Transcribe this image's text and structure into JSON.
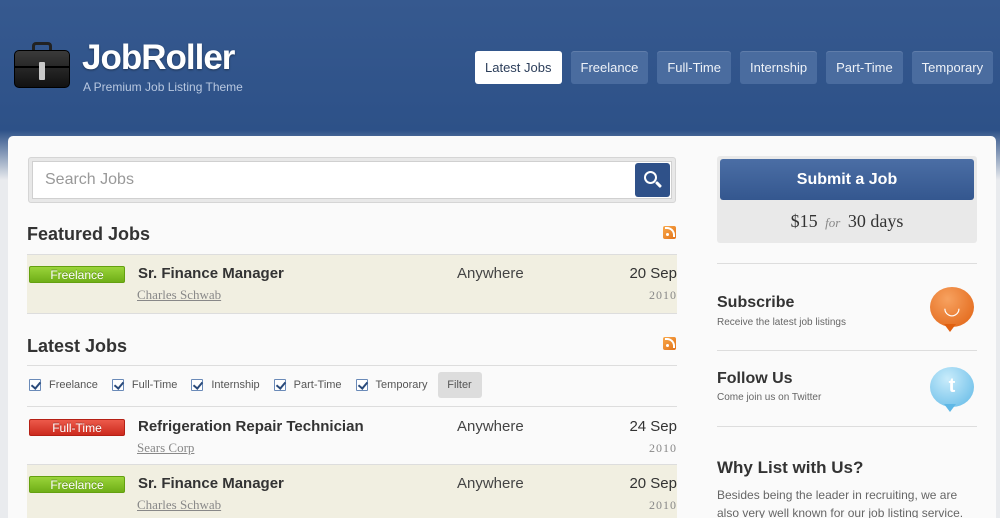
{
  "brand": {
    "title": "JobRoller",
    "tagline": "A Premium Job Listing Theme"
  },
  "nav": [
    {
      "label": "Latest Jobs",
      "active": true
    },
    {
      "label": "Freelance",
      "active": false
    },
    {
      "label": "Full-Time",
      "active": false
    },
    {
      "label": "Internship",
      "active": false
    },
    {
      "label": "Part-Time",
      "active": false
    },
    {
      "label": "Temporary",
      "active": false
    }
  ],
  "search": {
    "placeholder": "Search Jobs",
    "value": ""
  },
  "featured": {
    "title": "Featured Jobs",
    "jobs": [
      {
        "type": "Freelance",
        "title": "Sr. Finance Manager",
        "company": "Charles Schwab",
        "location": "Anywhere",
        "date": "20 Sep",
        "year": "2010"
      }
    ]
  },
  "latest": {
    "title": "Latest Jobs",
    "filters": [
      {
        "label": "Freelance",
        "checked": true
      },
      {
        "label": "Full-Time",
        "checked": true
      },
      {
        "label": "Internship",
        "checked": true
      },
      {
        "label": "Part-Time",
        "checked": true
      },
      {
        "label": "Temporary",
        "checked": true
      }
    ],
    "filter_button": "Filter",
    "jobs": [
      {
        "type": "Full-Time",
        "title": "Refrigeration Repair Technician",
        "company": "Sears Corp",
        "location": "Anywhere",
        "date": "24 Sep",
        "year": "2010"
      },
      {
        "type": "Freelance",
        "title": "Sr. Finance Manager",
        "company": "Charles Schwab",
        "location": "Anywhere",
        "date": "20 Sep",
        "year": "2010"
      }
    ]
  },
  "sidebar": {
    "submit": {
      "button": "Submit a Job",
      "price": "$15",
      "for": "for",
      "duration": "30 days"
    },
    "subscribe": {
      "title": "Subscribe",
      "subtitle": "Receive the latest job listings"
    },
    "follow": {
      "title": "Follow Us",
      "subtitle": "Come join us on Twitter",
      "glyph": "t"
    },
    "why": {
      "title": "Why List with Us?",
      "text": "Besides being the leader in recruiting, we are also very well known for our job listing service."
    }
  },
  "colors": {
    "header": "#2d5188",
    "freelance": "#7cbf22",
    "fulltime": "#d93a2c",
    "submit_button": "#3d609a"
  }
}
